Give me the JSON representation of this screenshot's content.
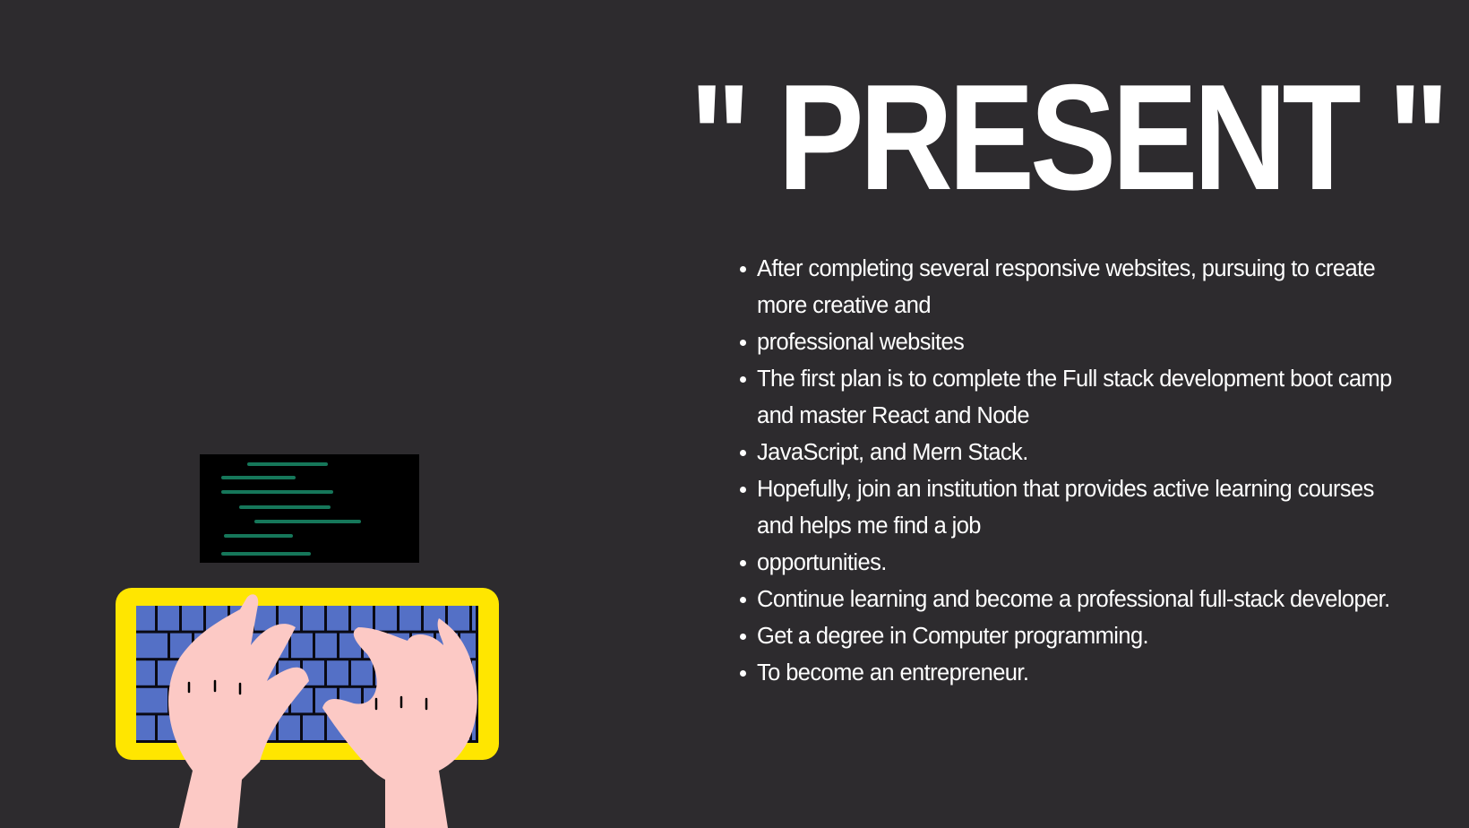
{
  "title": "\" PRESENT \"",
  "bullets": [
    "After completing several responsive websites, pursuing to create more creative and",
    "professional websites",
    "The first plan is to complete the Full stack development boot camp and master React and Node",
    "JavaScript, and Mern Stack.",
    "Hopefully, join an institution that provides active learning courses and helps me find a job",
    "opportunities.",
    "Continue learning and become a professional full-stack developer.",
    "Get a degree in Computer programming.",
    "To become an entrepreneur."
  ],
  "colors": {
    "background": "#2d2b2e",
    "screen": "#000000",
    "code_lines": "#16775a",
    "keyboard_frame": "#ffe600",
    "keys": "#5470c6",
    "hands": "#fcc9c5"
  }
}
